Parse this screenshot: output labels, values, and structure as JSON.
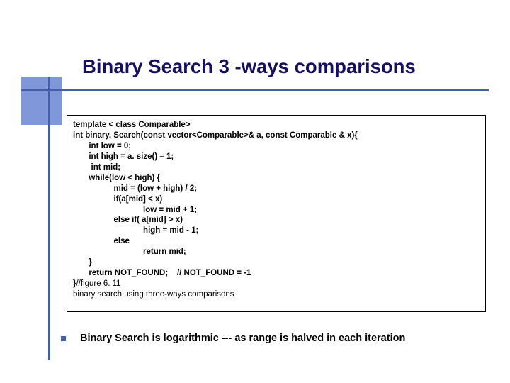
{
  "title": "Binary Search 3 -ways comparisons",
  "code": {
    "l1": "template < class Comparable>",
    "l2": "int binary. Search(const vector<Comparable>& a, const Comparable & x){",
    "l3": "       int low = 0;",
    "l4": "       int high = a. size() – 1;",
    "l5": "        int mid;",
    "l6": "       while(low < high) {",
    "l7": "                  mid = (low + high) / 2;",
    "l8": "                  if(a[mid] < x)",
    "l9": "                               low = mid + 1;",
    "l10": "                  else if( a[mid] > x)",
    "l11": "                               high = mid - 1;",
    "l12": "                  else",
    "l13": "                               return mid;",
    "l14": "       }",
    "l15": "       return NOT_FOUND;    // NOT_FOUND = -1",
    "l16a": "}",
    "l16b": "//figure 6. 11",
    "l17": "binary search using three-ways comparisons"
  },
  "bullet": "Binary Search is logarithmic --- as range is halved in each iteration"
}
